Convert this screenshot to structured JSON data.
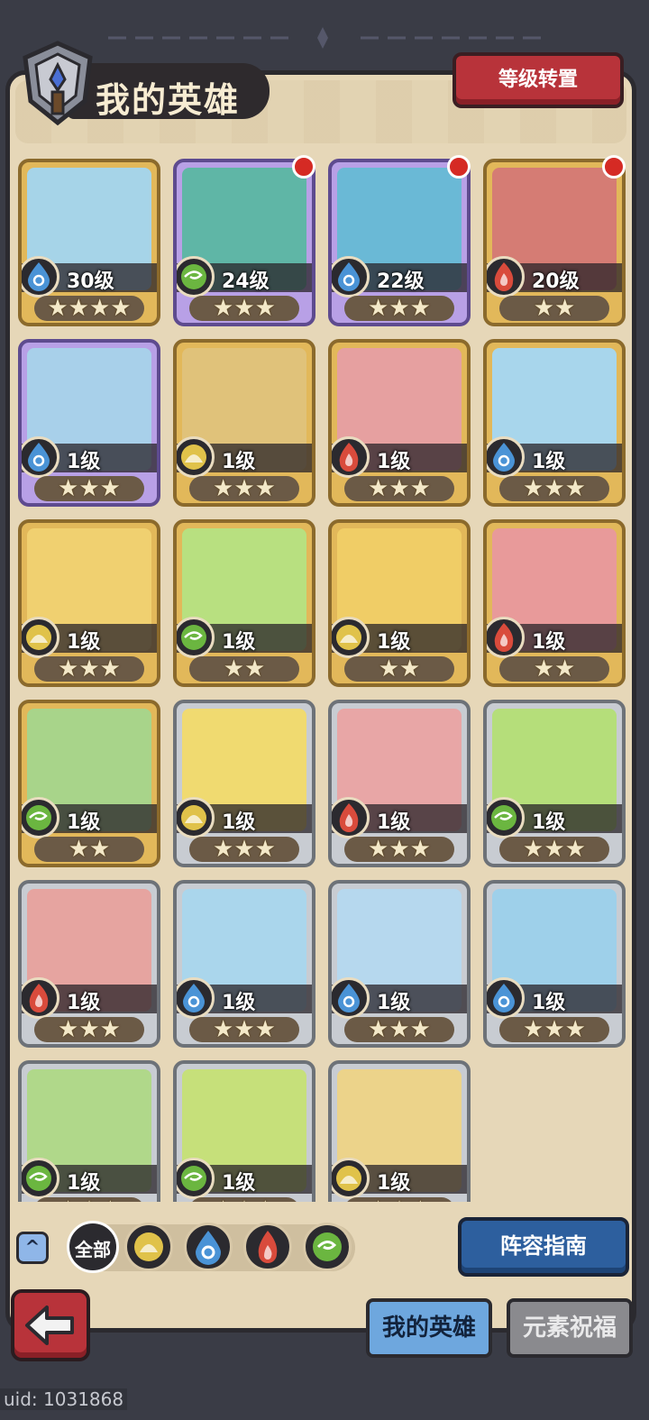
{
  "header": {
    "title": "我的英雄",
    "level_transfer_button": "等级转置"
  },
  "colors": {
    "water": "#4a93d6",
    "wind": "#6bb640",
    "earth": "#e0c24a",
    "fire": "#d94b3c",
    "rarity_gold": "#e2b85a",
    "rarity_purple": "#b8a0e6",
    "rarity_silver": "#c8ccd2"
  },
  "heroes": [
    {
      "level": "30级",
      "stars": "★★★★",
      "element": "water",
      "rarity": "gold",
      "new": false,
      "portrait_color": "#a6d4e8"
    },
    {
      "level": "24级",
      "stars": "★★★",
      "element": "wind",
      "rarity": "purple",
      "new": true,
      "portrait_color": "#5fb6a6"
    },
    {
      "level": "22级",
      "stars": "★★★",
      "element": "water",
      "rarity": "purple",
      "new": true,
      "portrait_color": "#6ab9d6"
    },
    {
      "level": "20级",
      "stars": "★★",
      "element": "fire",
      "rarity": "gold",
      "new": true,
      "portrait_color": "#d57c74"
    },
    {
      "level": "1级",
      "stars": "★★★",
      "element": "water",
      "rarity": "purple",
      "new": false,
      "portrait_color": "#a8d0ea"
    },
    {
      "level": "1级",
      "stars": "★★★",
      "element": "earth",
      "rarity": "gold",
      "new": false,
      "portrait_color": "#e0c27a"
    },
    {
      "level": "1级",
      "stars": "★★★",
      "element": "fire",
      "rarity": "gold",
      "new": false,
      "portrait_color": "#e6a0a0"
    },
    {
      "level": "1级",
      "stars": "★★★",
      "element": "water",
      "rarity": "gold",
      "new": false,
      "portrait_color": "#a8d6ec"
    },
    {
      "level": "1级",
      "stars": "★★★",
      "element": "earth",
      "rarity": "gold",
      "new": false,
      "portrait_color": "#f0d070"
    },
    {
      "level": "1级",
      "stars": "★★",
      "element": "wind",
      "rarity": "gold",
      "new": false,
      "portrait_color": "#b8e080"
    },
    {
      "level": "1级",
      "stars": "★★",
      "element": "earth",
      "rarity": "gold",
      "new": false,
      "portrait_color": "#f0cd66"
    },
    {
      "level": "1级",
      "stars": "★★",
      "element": "fire",
      "rarity": "gold",
      "new": false,
      "portrait_color": "#e89a9a"
    },
    {
      "level": "1级",
      "stars": "★★",
      "element": "wind",
      "rarity": "gold",
      "new": false,
      "portrait_color": "#a8d48a"
    },
    {
      "level": "1级",
      "stars": "★★★",
      "element": "earth",
      "rarity": "silver",
      "new": false,
      "portrait_color": "#f0da70"
    },
    {
      "level": "1级",
      "stars": "★★★",
      "element": "fire",
      "rarity": "silver",
      "new": false,
      "portrait_color": "#e8a6a6"
    },
    {
      "level": "1级",
      "stars": "★★★",
      "element": "wind",
      "rarity": "silver",
      "new": false,
      "portrait_color": "#b5de7a"
    },
    {
      "level": "1级",
      "stars": "★★★",
      "element": "fire",
      "rarity": "silver",
      "new": false,
      "portrait_color": "#e6a4a0"
    },
    {
      "level": "1级",
      "stars": "★★★",
      "element": "water",
      "rarity": "silver",
      "new": false,
      "portrait_color": "#aad6ec"
    },
    {
      "level": "1级",
      "stars": "★★★",
      "element": "water",
      "rarity": "silver",
      "new": false,
      "portrait_color": "#b6d8ee"
    },
    {
      "level": "1级",
      "stars": "★★★",
      "element": "water",
      "rarity": "silver",
      "new": false,
      "portrait_color": "#9ed0ea"
    },
    {
      "level": "1级",
      "stars": "★★★",
      "element": "wind",
      "rarity": "silver",
      "new": false,
      "portrait_color": "#b0d88a"
    },
    {
      "level": "1级",
      "stars": "★★★",
      "element": "wind",
      "rarity": "silver",
      "new": false,
      "portrait_color": "#c6e07a"
    },
    {
      "level": "1级",
      "stars": "★★★",
      "element": "earth",
      "rarity": "silver",
      "new": false,
      "portrait_color": "#ecd38a"
    }
  ],
  "filters": {
    "all_label": "全部",
    "elements": [
      "earth",
      "water",
      "fire",
      "wind"
    ]
  },
  "lineup_guide_button": "阵容指南",
  "tabs": {
    "my_heroes": "我的英雄",
    "element_blessing": "元素祝福"
  },
  "uid": "uid: 1031868"
}
